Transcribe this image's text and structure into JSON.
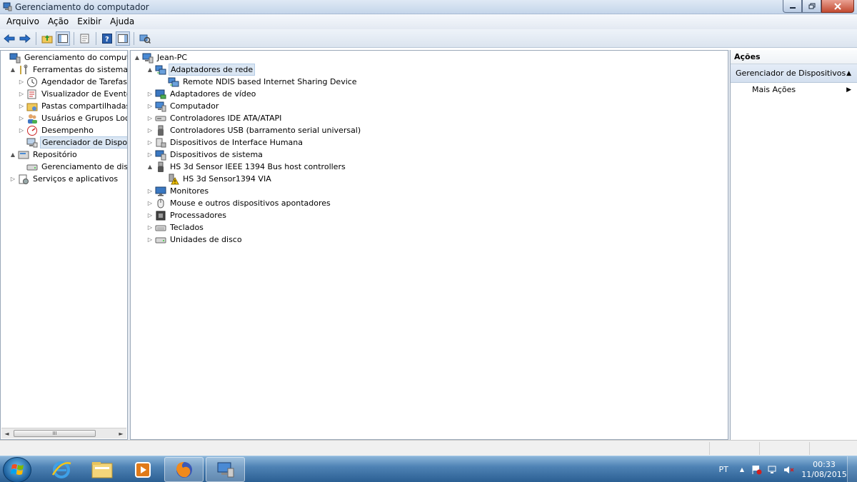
{
  "window": {
    "title": "Gerenciamento do computador"
  },
  "menu": [
    "Arquivo",
    "Ação",
    "Exibir",
    "Ajuda"
  ],
  "toolbar": {
    "icons": [
      "back-icon",
      "forward-icon",
      "up-folder-icon",
      "show-hide-tree-icon",
      "export-list-icon",
      "help-icon",
      "show-hide-action-pane-icon",
      "scan-hardware-icon"
    ]
  },
  "left_tree": [
    {
      "label": "Gerenciamento do computado",
      "icon": "computer-management-icon",
      "level": 0,
      "expander": ""
    },
    {
      "label": "Ferramentas do sistema",
      "icon": "tools-icon",
      "level": 1,
      "expander": "▲"
    },
    {
      "label": "Agendador de Tarefas",
      "icon": "clock-icon",
      "level": 2,
      "expander": "▷"
    },
    {
      "label": "Visualizador de Eventos",
      "icon": "event-viewer-icon",
      "level": 2,
      "expander": "▷"
    },
    {
      "label": "Pastas compartilhadas",
      "icon": "shared-folder-icon",
      "level": 2,
      "expander": "▷"
    },
    {
      "label": "Usuários e Grupos Loca",
      "icon": "users-icon",
      "level": 2,
      "expander": "▷"
    },
    {
      "label": "Desempenho",
      "icon": "performance-icon",
      "level": 2,
      "expander": "▷"
    },
    {
      "label": "Gerenciador de Disposit",
      "icon": "device-manager-icon",
      "level": 2,
      "expander": "",
      "selected": true
    },
    {
      "label": "Repositório",
      "icon": "storage-icon",
      "level": 1,
      "expander": "▲"
    },
    {
      "label": "Gerenciamento de disco",
      "icon": "disk-management-icon",
      "level": 2,
      "expander": ""
    },
    {
      "label": "Serviços e aplicativos",
      "icon": "services-icon",
      "level": 1,
      "expander": "▷"
    }
  ],
  "left_scroll": {
    "thumb_label": "III"
  },
  "device_tree": [
    {
      "label": "Jean-PC",
      "icon": "computer-icon",
      "level": 0,
      "expander": "▲"
    },
    {
      "label": "Adaptadores de rede",
      "icon": "network-adapter-icon",
      "level": 1,
      "expander": "▲",
      "selected": true
    },
    {
      "label": "Remote NDIS based Internet Sharing Device",
      "icon": "network-adapter-icon",
      "level": 2,
      "expander": ""
    },
    {
      "label": "Adaptadores de vídeo",
      "icon": "display-adapter-icon",
      "level": 1,
      "expander": "▷"
    },
    {
      "label": "Computador",
      "icon": "computer-icon",
      "level": 1,
      "expander": "▷"
    },
    {
      "label": "Controladores IDE ATA/ATAPI",
      "icon": "ide-controller-icon",
      "level": 1,
      "expander": "▷"
    },
    {
      "label": "Controladores USB (barramento serial universal)",
      "icon": "usb-icon",
      "level": 1,
      "expander": "▷"
    },
    {
      "label": "Dispositivos de Interface Humana",
      "icon": "hid-icon",
      "level": 1,
      "expander": "▷"
    },
    {
      "label": "Dispositivos de sistema",
      "icon": "system-device-icon",
      "level": 1,
      "expander": "▷"
    },
    {
      "label": "HS 3d Sensor IEEE 1394 Bus host controllers",
      "icon": "ieee1394-icon",
      "level": 1,
      "expander": "▲"
    },
    {
      "label": "HS 3d Sensor1394 VIA",
      "icon": "warning-device-icon",
      "level": 2,
      "expander": ""
    },
    {
      "label": "Monitores",
      "icon": "monitor-icon",
      "level": 1,
      "expander": "▷"
    },
    {
      "label": "Mouse e outros dispositivos apontadores",
      "icon": "mouse-icon",
      "level": 1,
      "expander": "▷"
    },
    {
      "label": "Processadores",
      "icon": "processor-icon",
      "level": 1,
      "expander": "▷"
    },
    {
      "label": "Teclados",
      "icon": "keyboard-icon",
      "level": 1,
      "expander": "▷"
    },
    {
      "label": "Unidades de disco",
      "icon": "disk-drive-icon",
      "level": 1,
      "expander": "▷"
    }
  ],
  "actions": {
    "title": "Ações",
    "section": "Gerenciador de Dispositivos",
    "items": [
      "Mais Ações"
    ]
  },
  "taskbar": {
    "apps": [
      "start-orb-icon",
      "internet-explorer-icon",
      "file-explorer-icon",
      "media-player-icon",
      "firefox-icon",
      "computer-management-taskbar-icon"
    ],
    "language": "PT",
    "time": "00:33",
    "date": "11/08/2015"
  },
  "colors": {
    "selection": "#dae6f3",
    "taskbar": "#2b5f93",
    "warning": "#f2c200"
  }
}
